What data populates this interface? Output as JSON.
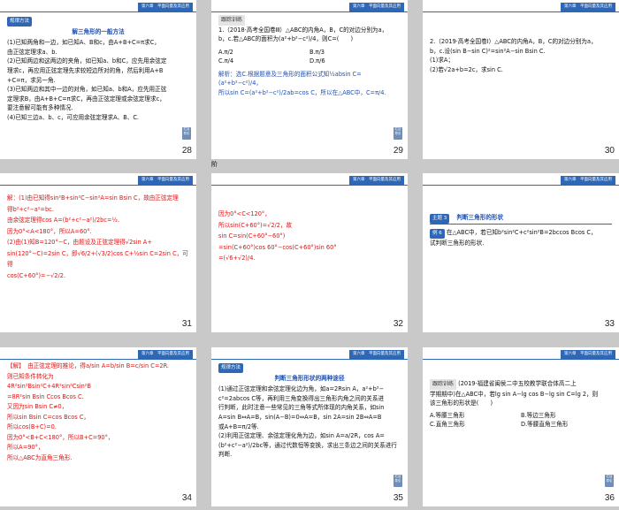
{
  "header": {
    "label": "第六章　平面向量及其应用"
  },
  "slides": {
    "s28": {
      "num": "28",
      "tag": "规律方法",
      "title": "解三角形的一般方法",
      "lines": [
        "(1)已知两角和一边，如已知A、B和c，由A+B+C=π求C，",
        "由正弦定理求a、b.",
        "(2)已知两边和这两边的夹角，如已知a、b和C，应先用余弦定",
        "理求c，再应用正弦定理先求较短边所对的角，然后利用A+B",
        "+C=π，求另一角.",
        "(3)已知两边和其中一边的对角，如已知a、b和A，应先用正弦",
        "定理求B，由A+B+C=π求C，再由正弦定理或余弦定理求c，",
        "要注意解可能有多种情况.",
        "(4)已知三边a、b、c，可应用余弦定理求A、B、C."
      ]
    },
    "s29": {
      "num": "29",
      "tag": "跟踪训练",
      "lines": [
        "1.（2018·高考全国卷Ⅲ）△ABC的内角A，B，C的对边分别为a，",
        "b，c.若△ABC的面积为(a²+b²−c²)/4，则C=(　　)"
      ],
      "options": [
        "A.π/2",
        "B.π/3",
        "C.π/4",
        "D.π/6"
      ],
      "solution": [
        "解析：选C.根据题意及三角形的面积公式知½absin C=(a²+b²−c²)/4，",
        "所以sin C=(a²+b²−c²)/2ab=cos C，所以在△ABC中，C=π/4."
      ]
    },
    "s30": {
      "num": "30",
      "lines": [
        "2.（2019·高考全国卷Ⅰ）△ABC的内角A，B，C的对边分别为a，",
        "b，c.设(sin B−sin C)²=sin²A−sin Bsin C.",
        "(1)求A；",
        "(2)若√2a+b=2c，求sin C."
      ]
    },
    "s31": {
      "num": "31",
      "lines": [
        "解：(1)由已知得sin²B+sin²C−sin²A=sin Bsin C，故由正弦定理",
        "得b²+c²−a²=bc.",
        "由余弦定理得cos A=(b²+c²−a²)/2bc=½.",
        "因为0°<A<180°，所以A=60°.",
        "(2)由(1)知B=120°−C，由题设及正弦定理得√2sin A+",
        "sin(120°−C)=2sin C，即√6/2+(√3/2)cos C+½sin C=2sin C，可得",
        "cos(C+60°)=−√2/2."
      ]
    },
    "s32": {
      "num": "32",
      "lines": [
        "因为0°<C<120°，",
        "所以sin(C+60°)=√2/2，故",
        "sin C=sin(C+60°−60°)",
        "=sin(C+60°)cos 60°−cos(C+60°)sin 60°",
        "=(√6+√2)/4."
      ]
    },
    "s33": {
      "num": "33",
      "tag": "主题 3",
      "title": "判断三角形的形状",
      "exnum": "例 6",
      "lines": [
        "在△ABC中，若已知b²sin²C+c²sin²B=2bccos Bcos C，",
        "试判断三角形的形状."
      ]
    },
    "s34": {
      "num": "34",
      "lines": [
        "【解】　由正弦定理的推论，得a/sin A=b/sin B=c/sin C=2R.",
        "则已知条件转化为",
        "4R²sin²Bsin²C+4R²sin²Csin²B",
        "=8R²sin Bsin Ccos Bcos C.",
        "又因为sin Bsin C≠0，",
        "所以sin Bsin C=cos Bcos C，",
        "所以cos(B+C)=0.",
        "因为0°<B+C<180°，所以B+C=90°，",
        "所以A=90°，",
        "所以△ABC为直角三角形."
      ]
    },
    "s35": {
      "num": "35",
      "tag": "规律方法",
      "title": "判断三角形形状的两种途径",
      "lines": [
        "(1)通过正弦定理和余弦定理化边为角，如a=2Rsin A，a²+b²−",
        "c²=2abcos C等，再利用三角变换得出三角形内角之间的关系进",
        "行判断，此时注意一些常见的三角等式所体现的内角关系，如sin",
        "A=sin B⇔A=B，sin(A−B)=0⇔A=B，sin 2A=sin 2B⇔A=B",
        "或A+B=π/2等.",
        "(2)利用正弦定理、余弦定理化角为边，如sin A=a/2R，cos A=",
        "(b²+c²−a²)/2bc等，通过代数恒等变换，求出三条边之间的关系进行",
        "判断."
      ]
    },
    "s36": {
      "num": "36",
      "tag": "跟踪训练",
      "lines": [
        "(2019·福建省闽侯二中五校教学联合体高二上",
        "学期期中)在△ABC中，若lg sin A−lg cos B−lg sin C=lg 2，则",
        "该三角形的形状是(　　)"
      ],
      "options": [
        "A.等腰三角形",
        "B.等边三角形",
        "C.直角三角形",
        "D.等腰直角三角形"
      ]
    }
  },
  "stray": "阶",
  "nav": {
    "btn": "栏目导引"
  }
}
